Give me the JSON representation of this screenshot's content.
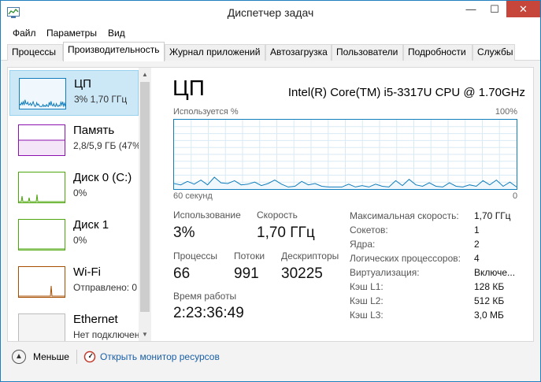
{
  "window": {
    "title": "Диспетчер задач",
    "controls": {
      "minimize": "—",
      "maximize": "☐",
      "close": "✕"
    }
  },
  "menu": [
    "Файл",
    "Параметры",
    "Вид"
  ],
  "tabs": [
    "Процессы",
    "Производительность",
    "Журнал приложений",
    "Автозагрузка",
    "Пользователи",
    "Подробности",
    "Службы"
  ],
  "active_tab": "Производительность",
  "sidebar": {
    "items": [
      {
        "name": "ЦП",
        "sub": "3% 1,70 ГГц",
        "color": "#117dbb",
        "selected": true
      },
      {
        "name": "Память",
        "sub": "2,8/5,9 ГБ (47%)",
        "color": "#8b12ae",
        "selected": false
      },
      {
        "name": "Диск 0 (C:)",
        "sub": "0%",
        "color": "#4da60c",
        "selected": false
      },
      {
        "name": "Диск 1",
        "sub": "0%",
        "color": "#4da60c",
        "selected": false
      },
      {
        "name": "Wi-Fi",
        "sub": "Отправлено: 0",
        "color": "#a74f01",
        "selected": false
      },
      {
        "name": "Ethernet",
        "sub": "Нет подключения",
        "color": "#a74f01",
        "selected": false
      }
    ]
  },
  "cpu": {
    "title": "ЦП",
    "model": "Intel(R) Core(TM) i5-3317U CPU @ 1.70GHz",
    "graph_label_left": "Используется %",
    "graph_label_right": "100%",
    "axis_left": "60 секунд",
    "axis_right": "0",
    "usage_history_percent": [
      8,
      6,
      11,
      7,
      13,
      6,
      17,
      9,
      8,
      12,
      6,
      7,
      10,
      5,
      8,
      13,
      7,
      3,
      4,
      11,
      6,
      8,
      4,
      3,
      3,
      3,
      7,
      3,
      5,
      3,
      7,
      4,
      3,
      12,
      5,
      14,
      6,
      4,
      9,
      4,
      3,
      9,
      4,
      3,
      6,
      4,
      12,
      6,
      13,
      4,
      10,
      3
    ],
    "stats": {
      "usage_label": "Использование",
      "usage_value": "3%",
      "speed_label": "Скорость",
      "speed_value": "1,70 ГГц",
      "processes_label": "Процессы",
      "processes_value": "66",
      "threads_label": "Потоки",
      "threads_value": "991",
      "handles_label": "Дескрипторы",
      "handles_value": "30225",
      "uptime_label": "Время работы",
      "uptime_value": "2:23:36:49"
    },
    "specs": [
      {
        "label": "Максимальная скорость:",
        "value": "1,70 ГГц"
      },
      {
        "label": "Сокетов:",
        "value": "1"
      },
      {
        "label": "Ядра:",
        "value": "2"
      },
      {
        "label": "Логических процессоров:",
        "value": "4"
      },
      {
        "label": "Виртуализация:",
        "value": "Включе..."
      },
      {
        "label": "Кэш L1:",
        "value": "128 КБ"
      },
      {
        "label": "Кэш L2:",
        "value": "512 КБ"
      },
      {
        "label": "Кэш L3:",
        "value": "3,0 МБ"
      }
    ]
  },
  "footer": {
    "fewer_label": "Меньше",
    "monitor_link": "Открыть монитор ресурсов"
  },
  "colors": {
    "cpu_accent": "#117dbb",
    "memory_accent": "#8b12ae",
    "disk_accent": "#4da60c",
    "network_accent": "#a74f01",
    "close_button": "#c7463c"
  }
}
